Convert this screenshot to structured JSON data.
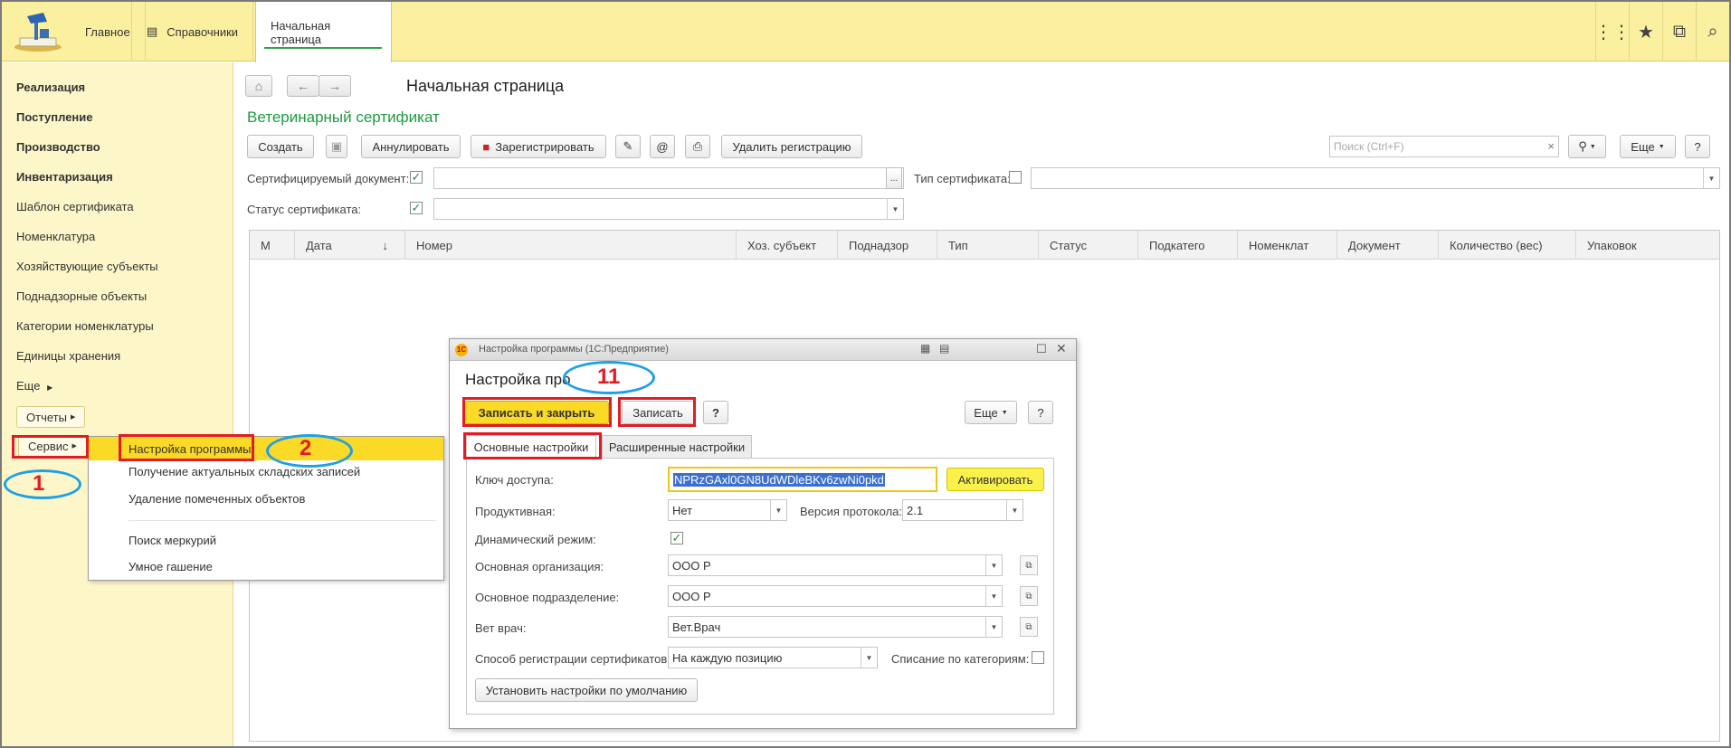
{
  "topbar": {
    "nav": [
      {
        "label": "Главное"
      },
      {
        "label": "Справочники"
      },
      {
        "label": "Начальная страница"
      }
    ]
  },
  "sidebar": {
    "items": [
      {
        "label": "Реализация",
        "bold": true
      },
      {
        "label": "Поступление",
        "bold": true
      },
      {
        "label": "Производство",
        "bold": true
      },
      {
        "label": "Инвентаризация",
        "bold": true
      },
      {
        "label": "Шаблон сертификата"
      },
      {
        "label": "Номенклатура"
      },
      {
        "label": "Хозяйствующие субъекты"
      },
      {
        "label": "Поднадзорные объекты"
      },
      {
        "label": "Категории номенклатуры"
      },
      {
        "label": "Единицы хранения"
      },
      {
        "label": "Еще"
      }
    ],
    "reports_label": "Отчеты",
    "service_label": "Сервис"
  },
  "main": {
    "page_title": "Начальная страница",
    "doc_title": "Ветеринарный сертификат",
    "toolbar": {
      "create": "Создать",
      "annul": "Аннулировать",
      "register": "Зарегистрировать",
      "at": "@",
      "remove_registration": "Удалить регистрацию",
      "search_placeholder": "Поиск (Ctrl+F)",
      "search_clear": "×",
      "more": "Еще",
      "help": "?"
    },
    "filters": {
      "doc_label": "Сертифицируемый документ:",
      "type_label": "Тип сертификата:",
      "status_label": "Статус сертификата:",
      "ellipsis": "..."
    },
    "table_columns": [
      "М",
      "Дата",
      "Номер",
      "Хоз. субъект",
      "Поднадзор",
      "Тип",
      "Статус",
      "Подкатего",
      "Номенклат",
      "Документ",
      "Количество (вес)",
      "Упаковок"
    ],
    "sort_indicator": "↓"
  },
  "context_menu": {
    "items": [
      {
        "label": "Настройка программы",
        "selected": true
      },
      {
        "label": "Получение актуальных складских записей"
      },
      {
        "label": "Удаление помеченных объектов"
      },
      {
        "label": "Поиск меркурий"
      },
      {
        "label": "Умное гашение"
      }
    ]
  },
  "dialog": {
    "window_title": "Настройка программы (1С:Предприятие)",
    "title": "Настройка про",
    "save_close": "Записать и закрыть",
    "save": "Записать",
    "help": "?",
    "more": "Еще",
    "tabs": [
      "Основные настройки",
      "Расширенные настройки"
    ],
    "fields": {
      "access_key_label": "Ключ доступа:",
      "access_key_value": "NPRzGAxl0GN8UdWDleBKv6zwNi0pkd",
      "activate": "Активировать",
      "productive_label": "Продуктивная:",
      "productive_value": "Нет",
      "protocol_label": "Версия протокола:",
      "protocol_value": "2.1",
      "dynamic_label": "Динамический режим:",
      "org_label": "Основная организация:",
      "org_value": "ООО Р",
      "dept_label": "Основное подразделение:",
      "dept_value": "ООО Р",
      "vet_label": "Вет врач:",
      "vet_value": "Вет.Врач",
      "reg_method_label": "Способ регистрации сертификатов:",
      "reg_method_value": "На каждую позицию",
      "writeoff_label": "Списание по категориям:",
      "default_btn": "Установить настройки по умолчанию"
    }
  },
  "annotations": {
    "n1": "1",
    "n2": "2",
    "n11": "11"
  },
  "colors": {
    "topbar": "#fbf0a0",
    "sidebar": "#fdf6c8",
    "accent_yellow": "#fbd927",
    "doc_title_green": "#1e9a42",
    "annotation_red": "#e31b23",
    "annotation_blue": "#1ea0e6"
  }
}
